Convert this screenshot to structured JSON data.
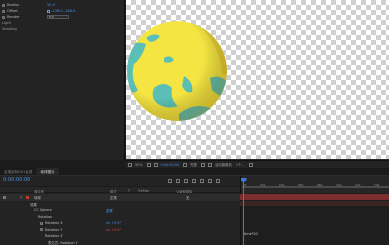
{
  "effect_controls": {
    "properties": [
      {
        "label": "Radius",
        "value": "50.0"
      },
      {
        "label": "Offset",
        "value": "-138.0,-168.0"
      },
      {
        "label": "Render",
        "value": "Full"
      }
    ],
    "sections": [
      "Light",
      "Shading"
    ]
  },
  "viewer": {
    "zoom": "50%",
    "view_mode": "完整",
    "camera": "活动摄像机",
    "views": "1个...",
    "time": "0:00:00:00"
  },
  "timeline": {
    "tabs": [
      "合成目标001合成",
      "地球图片"
    ],
    "timecode": "0:00:00:00",
    "columns": [
      "源名称",
      "模式",
      "T",
      "TrkMat",
      "父级和链接"
    ],
    "layers": [
      {
        "num": "1",
        "name": "地球",
        "mode": "正常",
        "parent": "无"
      },
      {
        "name": "效果"
      },
      {
        "name": "CC Sphere",
        "value": "重置"
      },
      {
        "name": "Rotation"
      },
      {
        "name": "Rotation X",
        "value": "0x +0.0°"
      },
      {
        "name": "Rotation Y",
        "value": "0x +0.0°"
      },
      {
        "name": "Rotation Z"
      },
      {
        "name": "表达式: Rotation Y"
      }
    ],
    "ruler_ticks": [
      "0f",
      "02s",
      "04s",
      "06s",
      "08s",
      "10s",
      "12s",
      "14s"
    ],
    "expression_text": "time*20"
  },
  "colors": {
    "accent": "#4a90e2",
    "globe_land": "#f4e542",
    "globe_ocean": "#5bbfb5",
    "panel_bg": "#232323"
  }
}
